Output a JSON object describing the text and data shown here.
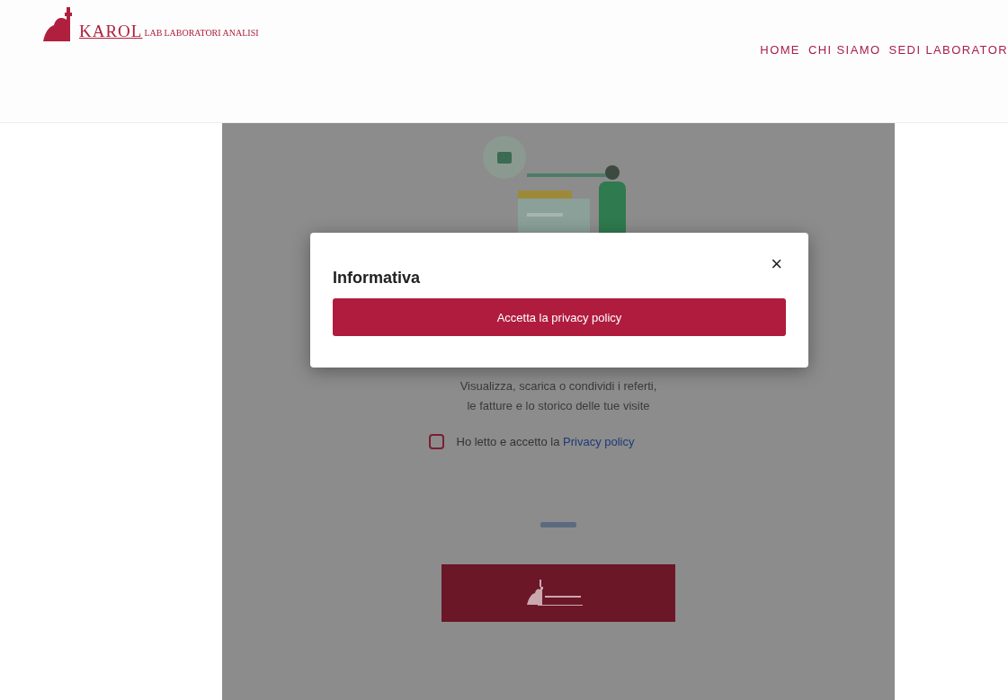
{
  "header": {
    "logo": {
      "brand": "KAROL",
      "lab": "LAB",
      "tagline": "LABORATORI ANALISI"
    },
    "nav": [
      {
        "label": "HOME"
      },
      {
        "label": "CHI SIAMO"
      },
      {
        "label": "SEDI LABORATOR"
      }
    ]
  },
  "page": {
    "description": [
      "Visualizza, scarica o condividi i referti,",
      "le fatture e lo storico delle tue visite"
    ],
    "consent": {
      "checked": false,
      "text": "Ho letto e accetto la ",
      "link": "Privacy policy"
    }
  },
  "modal": {
    "title": "Informativa",
    "close": "×",
    "button": "Accetta la privacy policy"
  }
}
